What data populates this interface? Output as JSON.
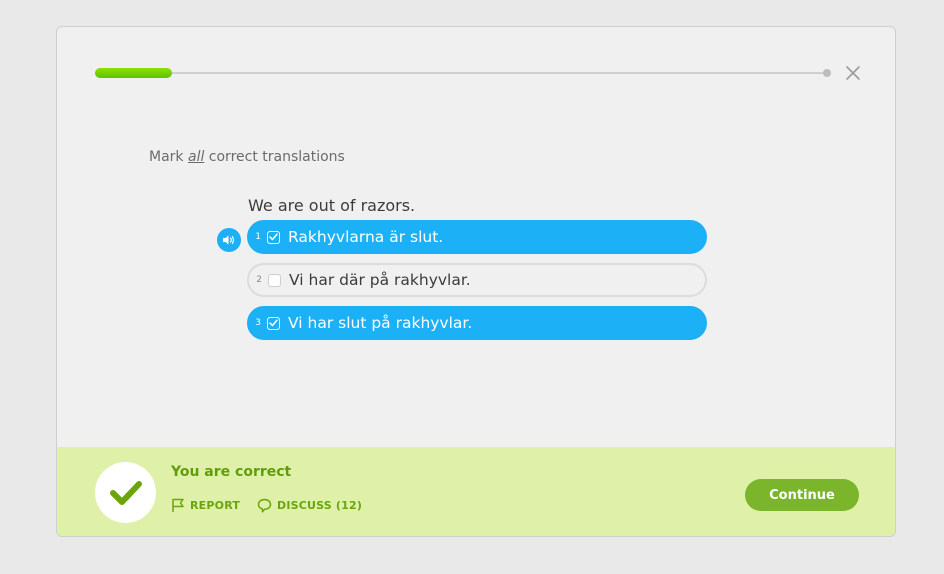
{
  "header": {
    "progress_fraction": 0.105,
    "close_icon": "close-icon"
  },
  "challenge": {
    "instruction_prefix": "Mark ",
    "instruction_emphasis": "all",
    "instruction_suffix": " correct translations",
    "prompt": "We are out of razors.",
    "speaker_icon": "speaker-icon",
    "options": [
      {
        "number": "1",
        "text": "Rakhyvlarna är slut.",
        "selected": true
      },
      {
        "number": "2",
        "text": "Vi har där på rakhyvlar.",
        "selected": false
      },
      {
        "number": "3",
        "text": "Vi har slut på rakhyvlar.",
        "selected": true
      }
    ]
  },
  "footer": {
    "status": "You are correct",
    "report_label": "REPORT",
    "discuss_label": "DISCUSS (12)",
    "continue_label": "Continue"
  },
  "colors": {
    "accent_blue": "#1cb0f6",
    "progress_green": "#78d700",
    "footer_bg": "#dff1a9",
    "success_green": "#5f9e0a",
    "continue_green": "#7ab52b"
  }
}
